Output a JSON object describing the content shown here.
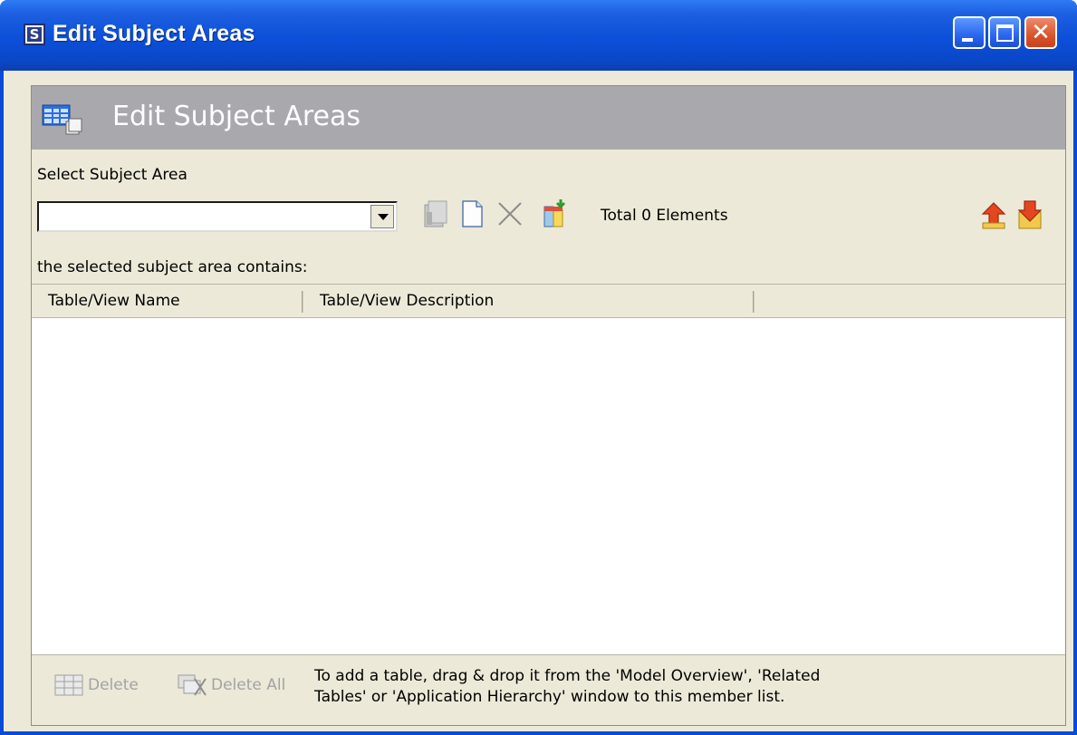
{
  "window": {
    "title": "Edit Subject Areas",
    "app_icon_letter": "S"
  },
  "panel": {
    "header_title": "Edit Subject Areas",
    "select_label": "Select Subject Area",
    "select_value": "",
    "total_label": "Total 0 Elements",
    "contains_label": "the selected subject area contains:"
  },
  "toolbar": {
    "icons": [
      "properties-icon",
      "new-document-icon",
      "delete-x-icon",
      "add-tables-icon",
      "export-icon",
      "import-icon"
    ]
  },
  "table": {
    "columns": [
      "Table/View Name",
      "Table/View Description"
    ],
    "rows": []
  },
  "footer": {
    "delete_label": "Delete",
    "delete_all_label": "Delete All",
    "hint": "To add a table, drag & drop it from the 'Model Overview', 'Related\nTables' or 'Application Hierarchy'  window to this member list."
  },
  "colors": {
    "titlebar": "#0a4ad8",
    "header_band": "#a9a9ad",
    "dialog_bg": "#ece9d8"
  }
}
